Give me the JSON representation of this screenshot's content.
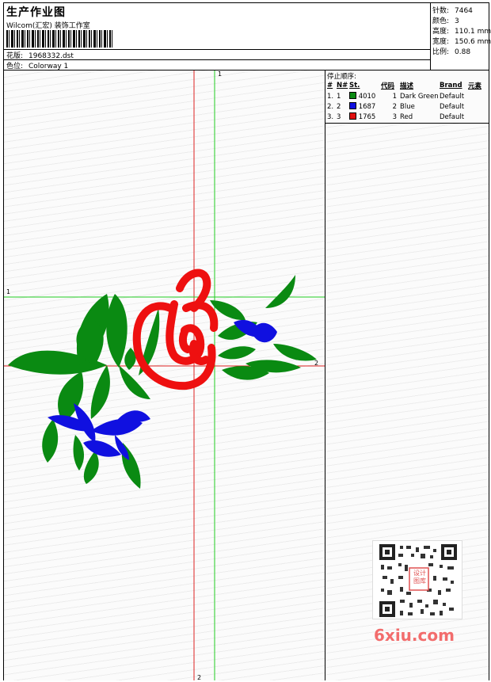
{
  "header": {
    "title": "生产作业图",
    "company": "Wilcom(汇宏) 装饰工作室",
    "design_label": "花版:",
    "design_value": "1968332.dst",
    "colorway_label": "色位:",
    "colorway_value": "Colorway 1"
  },
  "stats": [
    {
      "label": "针数:",
      "value": "7464"
    },
    {
      "label": "颜色:",
      "value": "3"
    },
    {
      "label": "高度:",
      "value": "110.1 mm"
    },
    {
      "label": "宽度:",
      "value": "150.6 mm"
    },
    {
      "label": "比例:",
      "value": "0.88"
    }
  ],
  "sequence": {
    "title": "停止顺序:",
    "headers": [
      "#",
      "N#",
      "St.",
      "代码",
      "描述",
      "Brand",
      "元素"
    ],
    "rows": [
      {
        "idx": "1.",
        "n": "1",
        "color": "#0a8a12",
        "st": "4010",
        "code": "1",
        "desc": "Dark Green",
        "brand": "Default"
      },
      {
        "idx": "2.",
        "n": "2",
        "color": "#1010e0",
        "st": "1687",
        "code": "2",
        "desc": "Blue",
        "brand": "Default"
      },
      {
        "idx": "3.",
        "n": "3",
        "color": "#e01010",
        "st": "1765",
        "code": "3",
        "desc": "Red",
        "brand": "Default"
      }
    ]
  },
  "guides": {
    "v1_label": "1",
    "v2_label": "2",
    "h1_label": "1",
    "h2_label": "2"
  },
  "colors": {
    "green": "#0a8a12",
    "blue": "#1010e0",
    "red": "#ee1010",
    "guide_green": "#22cc22",
    "guide_red": "#dd2222"
  },
  "watermark": "6xiu.com",
  "qr_stamp": "设计 图库"
}
